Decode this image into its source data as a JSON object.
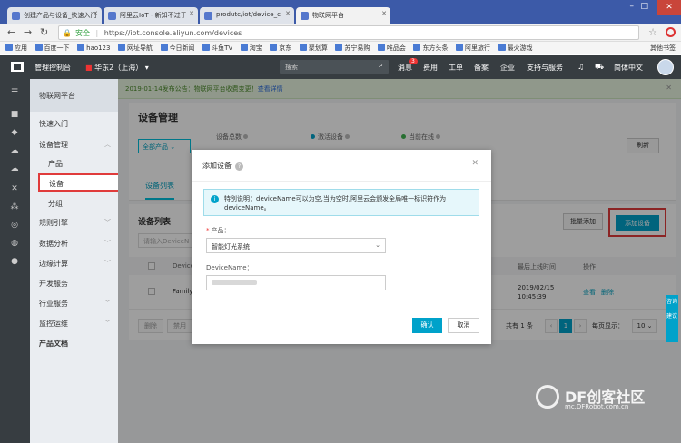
{
  "browser": {
    "tabs": [
      {
        "label": "创建产品与设备_快速入门"
      },
      {
        "label": "阿里云IoT - 新知不过于"
      },
      {
        "label": "produtc/iot/device_c"
      },
      {
        "label": "物联网平台"
      }
    ],
    "url_secure": "安全",
    "url": "https://iot.console.aliyun.com/devices",
    "bookmarks": [
      "应用",
      "百度一下",
      "hao123",
      "网址导航",
      "今日新闻",
      "斗鱼TV",
      "淘宝",
      "京东",
      "聚划算",
      "苏宁易购",
      "唯品会",
      "东方头条",
      "阿里旅行",
      "最火游戏"
    ],
    "bookmarks_right": "其他书签"
  },
  "console": {
    "title": "管理控制台",
    "region": "华东2（上海）",
    "search_placeholder": "搜索",
    "nav": [
      "消息",
      "费用",
      "工单",
      "备案",
      "企业",
      "支持与服务"
    ],
    "message_count": "3",
    "lang": "简体中文"
  },
  "sidebar": {
    "header": "物联网平台",
    "items": [
      {
        "label": "快速入门"
      },
      {
        "label": "设备管理"
      },
      {
        "label": "产品"
      },
      {
        "label": "设备"
      },
      {
        "label": "分组"
      },
      {
        "label": "规则引擎"
      },
      {
        "label": "数据分析"
      },
      {
        "label": "边缘计算"
      },
      {
        "label": "开发服务"
      },
      {
        "label": "行业服务"
      },
      {
        "label": "监控运维"
      },
      {
        "label": "产品文档"
      }
    ]
  },
  "notice": {
    "text": "2019-01-14发布公告：物联网平台收费变更！",
    "link": "查看详情"
  },
  "page": {
    "title": "设备管理",
    "product_select": "全部产品",
    "stats": [
      {
        "label": "设备总数"
      },
      {
        "label": "激活设备"
      },
      {
        "label": "当前在线"
      }
    ],
    "refresh": "刷新",
    "tab": "设备列表",
    "list_title": "设备列表",
    "search_placeholder": "请输入DeviceN",
    "batch_add": "批量添加",
    "add_device": "添加设备",
    "columns": [
      "DeviceN",
      "最后上线时间",
      "操作"
    ],
    "rows": [
      {
        "name": "Family",
        "last_online": "2019/02/15",
        "last_online_time": "10:45:39",
        "view": "查看",
        "delete": "删除"
      }
    ],
    "footer_delete": "删除",
    "footer_disable": "禁用",
    "total": "共有 1 条",
    "page_num": "1",
    "per_page_label": "每页显示：",
    "per_page": "10"
  },
  "modal": {
    "title": "添加设备",
    "tip": "特别说明：deviceName可以为空,当为空时,阿里云会颁发全局唯一标识符作为deviceName。",
    "product_label": "产品：",
    "product_value": "智能灯光系统",
    "device_name_label": "DeviceName：",
    "ok": "确认",
    "cancel": "取消"
  },
  "float_tab": [
    "咨询",
    "建议"
  ],
  "watermark": {
    "text": "DF创客社区",
    "sub": "mc.DFRobot.com.cn"
  },
  "colors": {
    "accent": "#00a2ca",
    "highlight": "#e03b3b",
    "topbar": "#373d41"
  }
}
